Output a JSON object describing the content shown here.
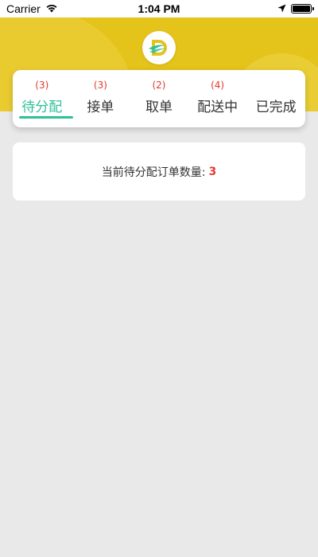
{
  "status_bar": {
    "carrier": "Carrier",
    "time": "1:04 PM",
    "battery_level": 1.0
  },
  "icons": {
    "wifi": "wifi-icon",
    "location": "location-arrow-icon",
    "battery": "battery-icon",
    "logo": "brand-logo-icon"
  },
  "colors": {
    "header": "#e4c31a",
    "active_tab": "#2fbf99",
    "count": "#e23b2f",
    "background": "#e9e9e9"
  },
  "tabs": [
    {
      "count": "(3)",
      "label": "待分配",
      "active": true
    },
    {
      "count": "(3)",
      "label": "接单",
      "active": false
    },
    {
      "count": "(2)",
      "label": "取单",
      "active": false
    },
    {
      "count": "(4)",
      "label": "配送中",
      "active": false
    },
    {
      "count": "",
      "label": "已完成",
      "active": false
    }
  ],
  "summary": {
    "label": "当前待分配订单数量:",
    "count": "3"
  }
}
